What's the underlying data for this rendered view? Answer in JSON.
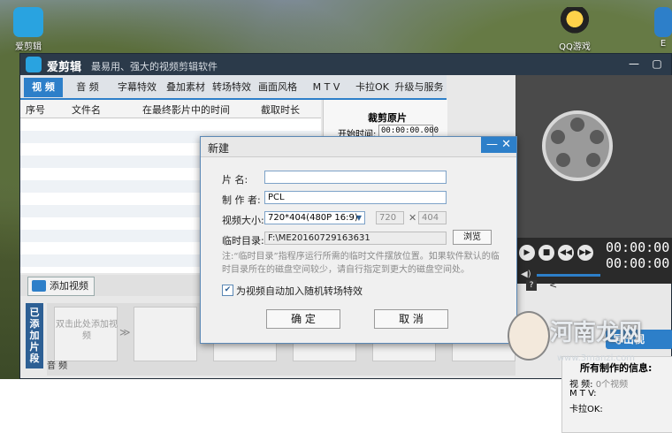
{
  "desktop": {
    "icons": [
      {
        "label": "爱剪辑"
      },
      {
        "label": "QQ游戏"
      },
      {
        "label": "E"
      }
    ]
  },
  "app": {
    "name": "爱剪辑",
    "slogan": "最易用、强大的视频剪辑软件",
    "tabs": [
      "视 频",
      "音 频",
      "字幕特效",
      "叠加素材",
      "转场特效",
      "画面风格",
      "M T V",
      "卡拉OK",
      "升级与服务"
    ],
    "list_headers": [
      "序号",
      "文件名",
      "在最终影片中的时间",
      "截取时长"
    ],
    "crop_panel": {
      "title": "裁剪原片",
      "start_label": "开始时间:",
      "start_value": "00:00:00.000"
    },
    "timecode_1": "00:00:00.",
    "timecode_2": "00:00:00.",
    "add_video_label": "添加视频",
    "sidebar_label": "已添加片段",
    "clip_hint": "双击此处添加视频",
    "audio_label": "音 频",
    "export_label": "导出视",
    "info_title": "所有制作的信息:",
    "info_rows": [
      {
        "k": "视  频:",
        "v": "0个视频"
      },
      {
        "k": "M  T  V:",
        "v": ""
      },
      {
        "k": "卡拉OK:",
        "v": ""
      }
    ]
  },
  "dialog": {
    "title": "新建",
    "film_name_label": "片  名:",
    "film_name_value": "",
    "producer_label": "制 作 者:",
    "producer_value": "PCL",
    "size_label": "视频大小:",
    "size_value": "720*404(480P 16:9)",
    "width_value": "720",
    "height_value": "404",
    "tempdir_label": "临时目录:",
    "tempdir_value": "F:\\ME20160729163631",
    "browse_label": "浏览",
    "note": "注:“临时目录”指程序运行所需的临时文件摆放位置。如果软件默认的临时目录所在的磁盘空间较少，请自行指定到更大的磁盘空间处。",
    "checkbox_label": "为视频自动加入随机转场特效",
    "checkbox_checked": true,
    "ok_label": "确 定",
    "cancel_label": "取 消"
  },
  "watermark": {
    "text": "河南龙网",
    "url": "www.3manzi.com"
  }
}
